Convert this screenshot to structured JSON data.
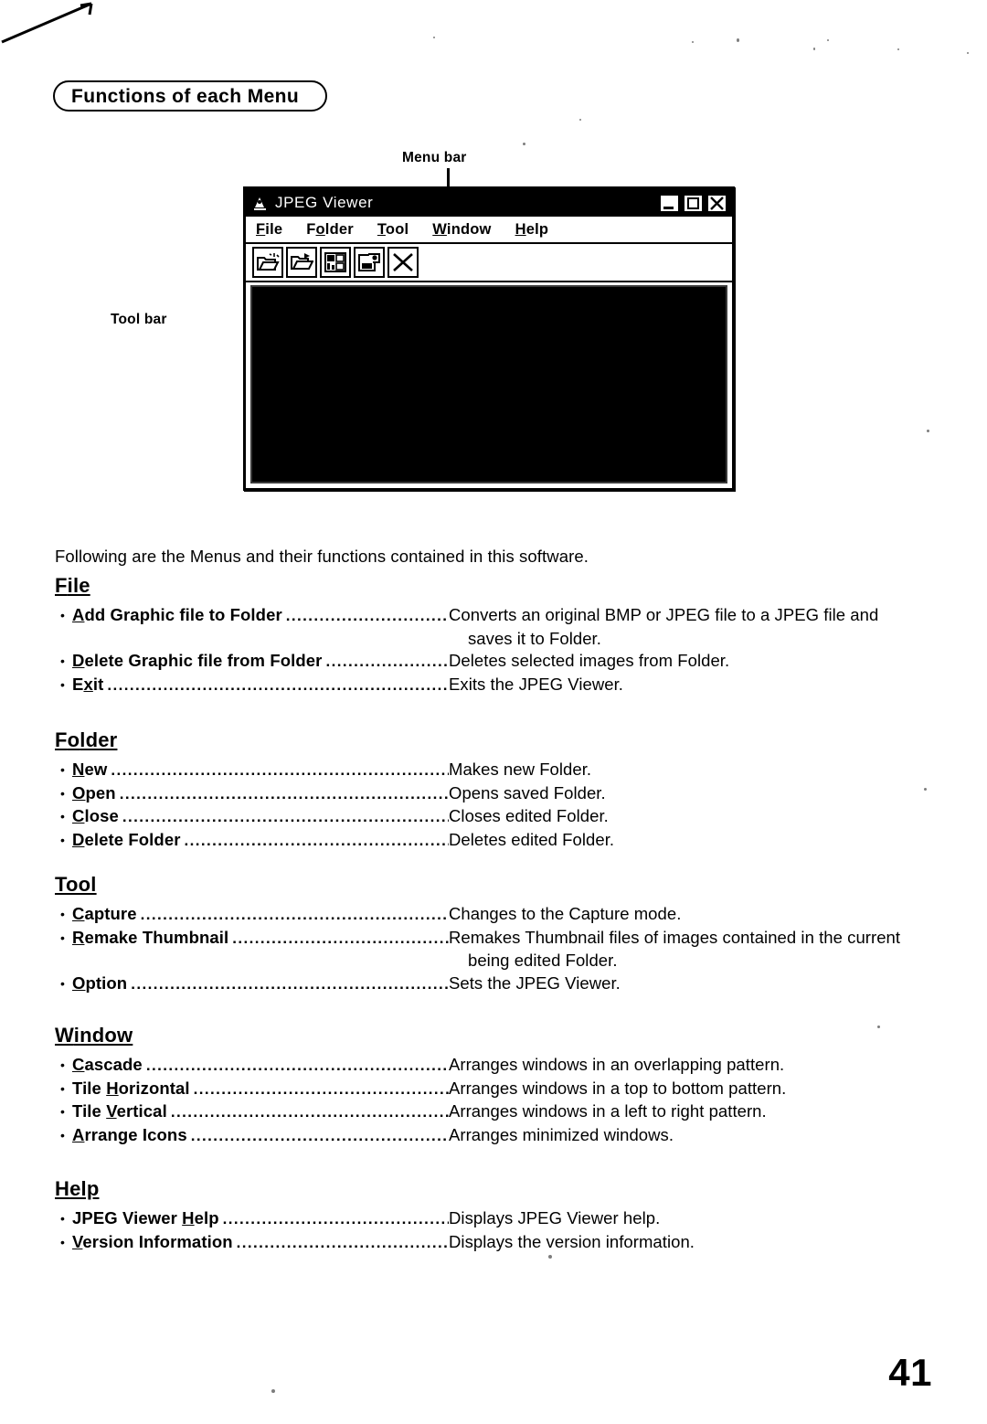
{
  "banner": {
    "title": "Functions of each Menu"
  },
  "callouts": {
    "menu_bar": "Menu bar",
    "tool_bar": "Tool bar"
  },
  "app_window": {
    "title": "JPEG Viewer",
    "title_icon": "jpeg-viewer-app-icon",
    "window_buttons": [
      {
        "name": "minimize",
        "glyph": "_"
      },
      {
        "name": "maximize",
        "glyph": "□"
      },
      {
        "name": "close",
        "glyph": "×"
      }
    ],
    "menus": [
      {
        "label": "File",
        "accel": "F",
        "before": "",
        "after": "ile"
      },
      {
        "label": "Folder",
        "accel": "o",
        "before": "F",
        "after": "lder"
      },
      {
        "label": "Tool",
        "accel": "T",
        "before": "",
        "after": "ool"
      },
      {
        "label": "Window",
        "accel": "W",
        "before": "",
        "after": "indow"
      },
      {
        "label": "Help",
        "accel": "H",
        "before": "",
        "after": "elp"
      }
    ],
    "toolbar_buttons": [
      {
        "name": "add-graphic-file-icon",
        "tip": "Add Graphic file to Folder"
      },
      {
        "name": "open-folder-icon",
        "tip": "Open"
      },
      {
        "name": "remake-thumbnail-icon",
        "tip": "Remake Thumbnail"
      },
      {
        "name": "capture-icon",
        "tip": "Capture"
      },
      {
        "name": "exit-icon",
        "tip": "Exit"
      }
    ],
    "client_area": "black-image-viewing-area"
  },
  "intro": "Following are the Menus and their functions contained in this software.",
  "sections": [
    {
      "id": "file",
      "title": {
        "before": "",
        "accel": "F",
        "after": "ile"
      },
      "entries": [
        {
          "before": "",
          "accel": "A",
          "after": "dd Graphic file to Folder",
          "desc": "Converts an original BMP or JPEG file to a JPEG file and",
          "desc_cont": "saves it to Folder."
        },
        {
          "before": "",
          "accel": "D",
          "after": "elete Graphic file from Folder",
          "desc": "Deletes selected images from Folder.",
          "desc_cont": ""
        },
        {
          "before": "E",
          "accel": "x",
          "after": "it",
          "desc": "Exits the JPEG Viewer.",
          "desc_cont": ""
        }
      ]
    },
    {
      "id": "folder",
      "title": {
        "before": "F",
        "accel": "o",
        "after": "lder"
      },
      "entries": [
        {
          "before": "",
          "accel": "N",
          "after": "ew",
          "desc": "Makes new Folder.",
          "desc_cont": ""
        },
        {
          "before": "",
          "accel": "O",
          "after": "pen",
          "desc": "Opens saved Folder.",
          "desc_cont": ""
        },
        {
          "before": "",
          "accel": "C",
          "after": "lose",
          "desc": "Closes edited Folder.",
          "desc_cont": ""
        },
        {
          "before": "",
          "accel": "D",
          "after": "elete Folder",
          "desc": "Deletes edited Folder.",
          "desc_cont": ""
        }
      ]
    },
    {
      "id": "tool",
      "title": {
        "before": "",
        "accel": "T",
        "after": "ool"
      },
      "entries": [
        {
          "before": "",
          "accel": "C",
          "after": "apture",
          "desc": "Changes to the Capture mode.",
          "desc_cont": ""
        },
        {
          "before": "",
          "accel": "R",
          "after": "emake Thumbnail",
          "desc": "Remakes Thumbnail files of images contained in the current",
          "desc_cont": "being edited Folder."
        },
        {
          "before": "",
          "accel": "O",
          "after": "ption",
          "desc": "Sets the JPEG Viewer.",
          "desc_cont": ""
        }
      ]
    },
    {
      "id": "window",
      "title": {
        "before": "",
        "accel": "W",
        "after": "indow"
      },
      "entries": [
        {
          "before": "",
          "accel": "C",
          "after": "ascade",
          "desc": "Arranges windows in an overlapping pattern.",
          "desc_cont": ""
        },
        {
          "before": "Tile ",
          "accel": "H",
          "after": "orizontal",
          "desc": "Arranges windows in a top to bottom pattern.",
          "desc_cont": ""
        },
        {
          "before": "Tile ",
          "accel": "V",
          "after": "ertical",
          "desc": "Arranges windows in a left to right pattern.",
          "desc_cont": ""
        },
        {
          "before": "",
          "accel": "A",
          "after": "rrange Icons",
          "desc": "Arranges minimized windows.",
          "desc_cont": ""
        }
      ]
    },
    {
      "id": "help",
      "title": {
        "before": "",
        "accel": "H",
        "after": "elp"
      },
      "entries": [
        {
          "before": "JPEG Viewer ",
          "accel": "H",
          "after": "elp",
          "desc": "Displays JPEG Viewer help.",
          "desc_cont": ""
        },
        {
          "before": "",
          "accel": "V",
          "after": "ersion Information",
          "desc": "Displays the version information.",
          "desc_cont": ""
        }
      ]
    }
  ],
  "page_number": "41",
  "colors": {
    "ink": "#000000",
    "paper": "#ffffff",
    "titlebar_bg": "#000000",
    "titlebar_text": "#ffffff",
    "client_area": "#000000"
  }
}
